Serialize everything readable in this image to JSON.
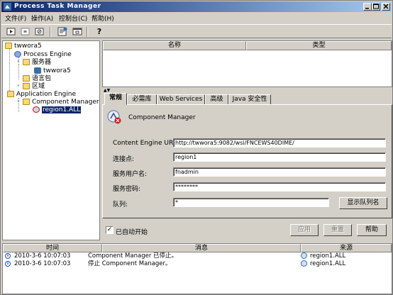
{
  "window": {
    "title": "Process Task Manager"
  },
  "menu": {
    "file": "文件(F)",
    "action": "操作(A)",
    "console": "控制台(C)",
    "help": "帮助(H)"
  },
  "toolbar": {
    "help_label": "?"
  },
  "tree": {
    "root": "twwora5",
    "process_engine": "Process Engine",
    "servers": "服务器",
    "server_node": "twwora5",
    "language_pack": "语言包",
    "regions": "区域",
    "application_engine": "Application Engine",
    "component_manager": "Component Manager",
    "region_item": "region1.ALL"
  },
  "props_table": {
    "col_name": "名称",
    "col_type": "类型"
  },
  "tabs": [
    {
      "label": "常规"
    },
    {
      "label": "必需库"
    },
    {
      "label": "Web Services"
    },
    {
      "label": "高级"
    },
    {
      "label": "Java 安全性"
    }
  ],
  "panel": {
    "title": "Component Manager",
    "uri_label": "Content Engine URI:",
    "uri_value": "http://twwora5:9082/wsi/FNCEWS40DIME/",
    "connection_label": "连接点:",
    "connection_value": "region1",
    "user_label": "服务用户名:",
    "user_value": "fnadmin",
    "password_label": "服务密码:",
    "password_value": "********",
    "queue_label": "队列:",
    "queue_value": "*",
    "show_queues_button": "显示队列名",
    "auto_start_label": "已自动开始",
    "auto_start_checked": true,
    "apply_button": "应用",
    "reset_button": "重置",
    "help_button": "帮助"
  },
  "log": {
    "col_time": "时间",
    "col_message": "消息",
    "col_source": "来源",
    "rows": [
      {
        "time": "2010-3-6 10:07:03",
        "message": "Component Manager 已停止。",
        "source": "region1.ALL"
      },
      {
        "time": "2010-3-6 10:07:03",
        "message": "停止 Component Manager。",
        "source": "region1.ALL"
      }
    ]
  },
  "colors": {
    "title_bar_start": "#0a246a",
    "title_bar_end": "#a6caf0",
    "window_face": "#d4d0c8",
    "selection": "#0a246a"
  }
}
